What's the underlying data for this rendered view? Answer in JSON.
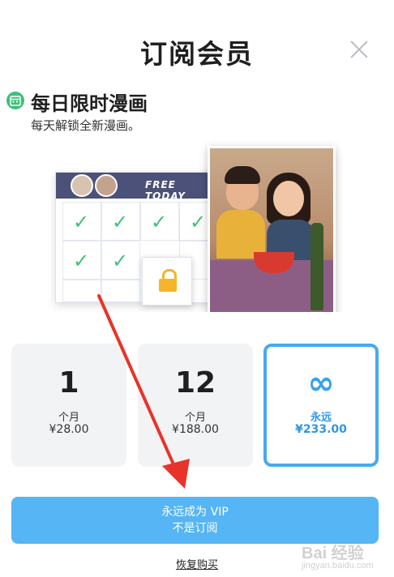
{
  "header": {
    "title": "订阅会员"
  },
  "feature": {
    "title": "每日限时漫画",
    "subtitle": "每天解锁全新漫画。",
    "banner_label": "FREE TODAY"
  },
  "plans": [
    {
      "big": "1",
      "unit": "个月",
      "price": "¥28.00",
      "selected": false
    },
    {
      "big": "12",
      "unit": "个月",
      "price": "¥188.00",
      "selected": false
    },
    {
      "big": "∞",
      "unit": "永远",
      "price": "¥233.00",
      "selected": true
    }
  ],
  "cta": {
    "line1": "永远成为 VIP",
    "line2": "不是订阅"
  },
  "restore_label": "恢复购买",
  "watermark": {
    "text": "Bai 经验",
    "url": "jingyan.baidu.com"
  },
  "colors": {
    "accent": "#47a9ef",
    "cta": "#55b5f5",
    "check": "#42c07a",
    "arrow": "#e8332a"
  }
}
